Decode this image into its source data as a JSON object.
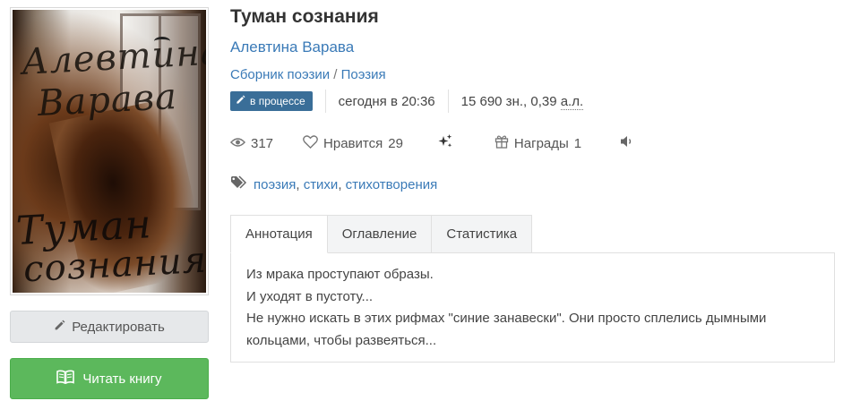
{
  "book": {
    "title": "Туман сознания",
    "author": "Алевтина Варава",
    "genre_primary": "Сборник поэзии",
    "genre_separator": "/",
    "genre_secondary": "Поэзия",
    "cover": {
      "author_line1": "Алевтина",
      "author_line2": "Варава",
      "title_line1": "Туман",
      "title_line2": "сознания"
    }
  },
  "meta": {
    "status_badge": "в процессе",
    "updated": "сегодня в 20:36",
    "size_chars": "15 690 зн., 0,39",
    "size_unit": "а.л."
  },
  "stats": {
    "views": "317",
    "likes_label": "Нравится",
    "likes_count": "29",
    "awards_label": "Награды",
    "awards_count": "1"
  },
  "tags": [
    "поэзия",
    "стихи",
    "стихотворения"
  ],
  "tabs": [
    "Аннотация",
    "Оглавление",
    "Статистика"
  ],
  "annotation": [
    "Из мрака проступают образы.",
    "И уходят в пустоту...",
    "Не нужно искать в этих рифмах \"синие занавески\". Они просто сплелись дымными",
    "кольцами, чтобы развеяться..."
  ],
  "buttons": {
    "edit": "Редактировать",
    "read": "Читать книгу"
  },
  "colors": {
    "link": "#3a7ab7",
    "badge": "#3a6e98",
    "read_button": "#5cb85c"
  }
}
